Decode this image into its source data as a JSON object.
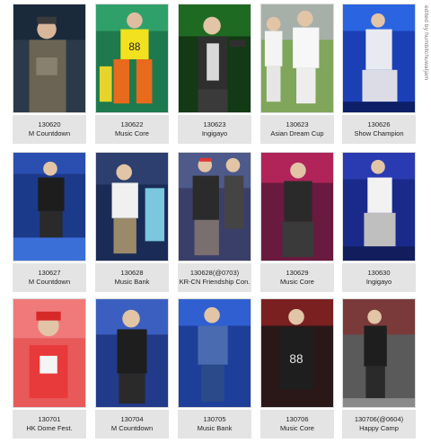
{
  "watermark": "edited by humbitchuwaljam",
  "cards": [
    {
      "date": "130620",
      "show": "M Countdown"
    },
    {
      "date": "130622",
      "show": "Music Core"
    },
    {
      "date": "130623",
      "show": "Ingigayo"
    },
    {
      "date": "130623",
      "show": "Asian Dream Cup"
    },
    {
      "date": "130626",
      "show": "Show Champion"
    },
    {
      "date": "130627",
      "show": "M Countdown"
    },
    {
      "date": "130628",
      "show": "Music Bank"
    },
    {
      "date": "130628(@0703)",
      "show": "KR-CN Friendship Con."
    },
    {
      "date": "130629",
      "show": "Music Core"
    },
    {
      "date": "130630",
      "show": "Ingigayo"
    },
    {
      "date": "130701",
      "show": "HK Dome Fest."
    },
    {
      "date": "130704",
      "show": "M Countdown"
    },
    {
      "date": "130705",
      "show": "Music Bank"
    },
    {
      "date": "130706",
      "show": "Music Core"
    },
    {
      "date": "130706(@0604)",
      "show": "Happy Camp"
    }
  ]
}
